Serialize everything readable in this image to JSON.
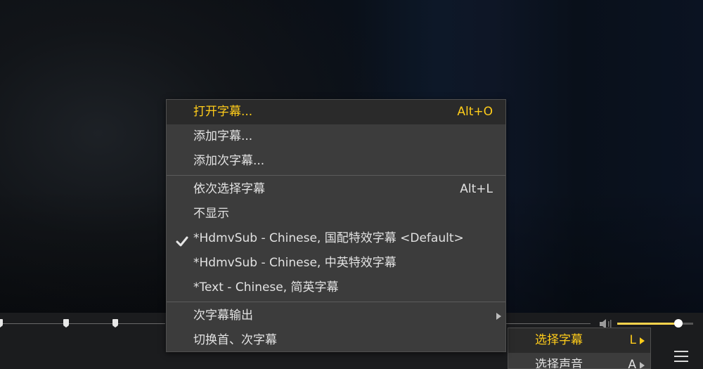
{
  "context_menu": {
    "items": [
      {
        "label": "打开字幕...",
        "shortcut": "Alt+O"
      },
      {
        "label": "添加字幕..."
      },
      {
        "label": "添加次字幕..."
      },
      {
        "label": "依次选择字幕",
        "shortcut": "Alt+L"
      },
      {
        "label": "不显示"
      },
      {
        "label": "*HdmvSub - Chinese, 国配特效字幕 <Default>",
        "checked": true
      },
      {
        "label": "*HdmvSub - Chinese, 中英特效字幕"
      },
      {
        "label": "*Text - Chinese, 简英字幕"
      },
      {
        "label": "次字幕输出",
        "submenu": true
      },
      {
        "label": "切换首、次字幕"
      }
    ]
  },
  "parent_menu": {
    "items": [
      {
        "label": "选择字幕",
        "shortcut": "L"
      },
      {
        "label": "选择声音",
        "shortcut": "A"
      }
    ]
  },
  "colors": {
    "accent": "#ffcc1a",
    "menu_bg": "#3c3c3c",
    "text": "#e2e2e2"
  },
  "icons": {
    "checkmark": "check-icon",
    "submenu_arrow": "chevron-right-icon",
    "volume": "speaker-icon",
    "main_menu": "hamburger-icon"
  },
  "volume": {
    "level": 0.82
  }
}
